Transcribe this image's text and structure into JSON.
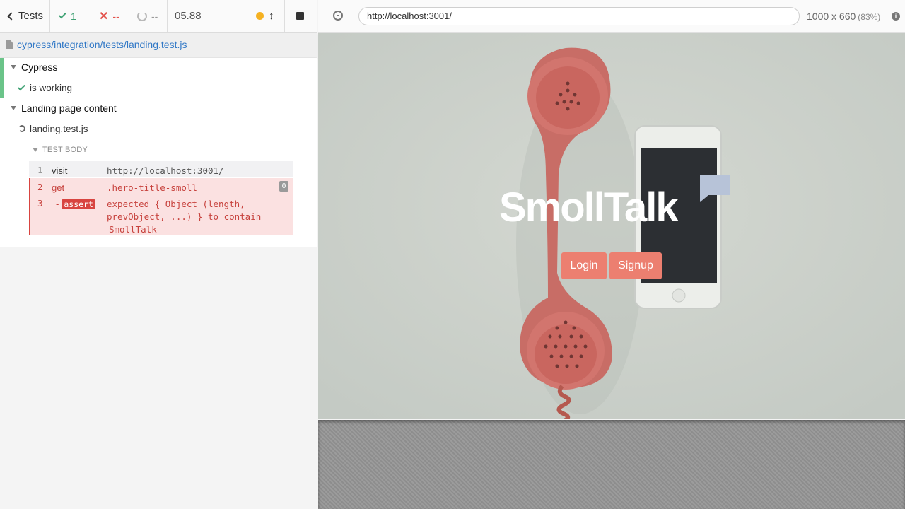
{
  "reporter": {
    "header": {
      "back_label": "Tests",
      "passed": "1",
      "failed": "--",
      "pending": "--",
      "duration": "05.88"
    },
    "spec_path": "cypress/integration/tests/landing.test.js",
    "suites": [
      {
        "title": "Cypress",
        "tests": [
          {
            "title": "is working",
            "state": "passed"
          }
        ]
      },
      {
        "title": "Landing page content",
        "tests": [
          {
            "title": "landing.test.js",
            "state": "running"
          }
        ]
      }
    ],
    "test_body_label": "TEST BODY",
    "commands": [
      {
        "number": "1",
        "name": "visit",
        "message": "http://localhost:3001/",
        "state": "passed"
      },
      {
        "number": "2",
        "name": "get",
        "message": ".hero-title-smoll",
        "count": "0",
        "state": "failed"
      },
      {
        "number": "3",
        "prefix": "-",
        "name": "assert",
        "message_lines": [
          "expected { Object (length,",
          "prevObject, ...) } to contain",
          "SmollTalk"
        ],
        "state": "failed"
      }
    ]
  },
  "runner": {
    "url": "http://localhost:3001/",
    "viewport": "1000 x 660",
    "scale": "(83%)"
  },
  "app": {
    "hero_title": "SmollTalk",
    "login_label": "Login",
    "signup_label": "Signup"
  },
  "colors": {
    "pass": "#3ea173",
    "fail": "#e3524c",
    "link": "#3178c6",
    "accent_button": "#ec7f70"
  }
}
